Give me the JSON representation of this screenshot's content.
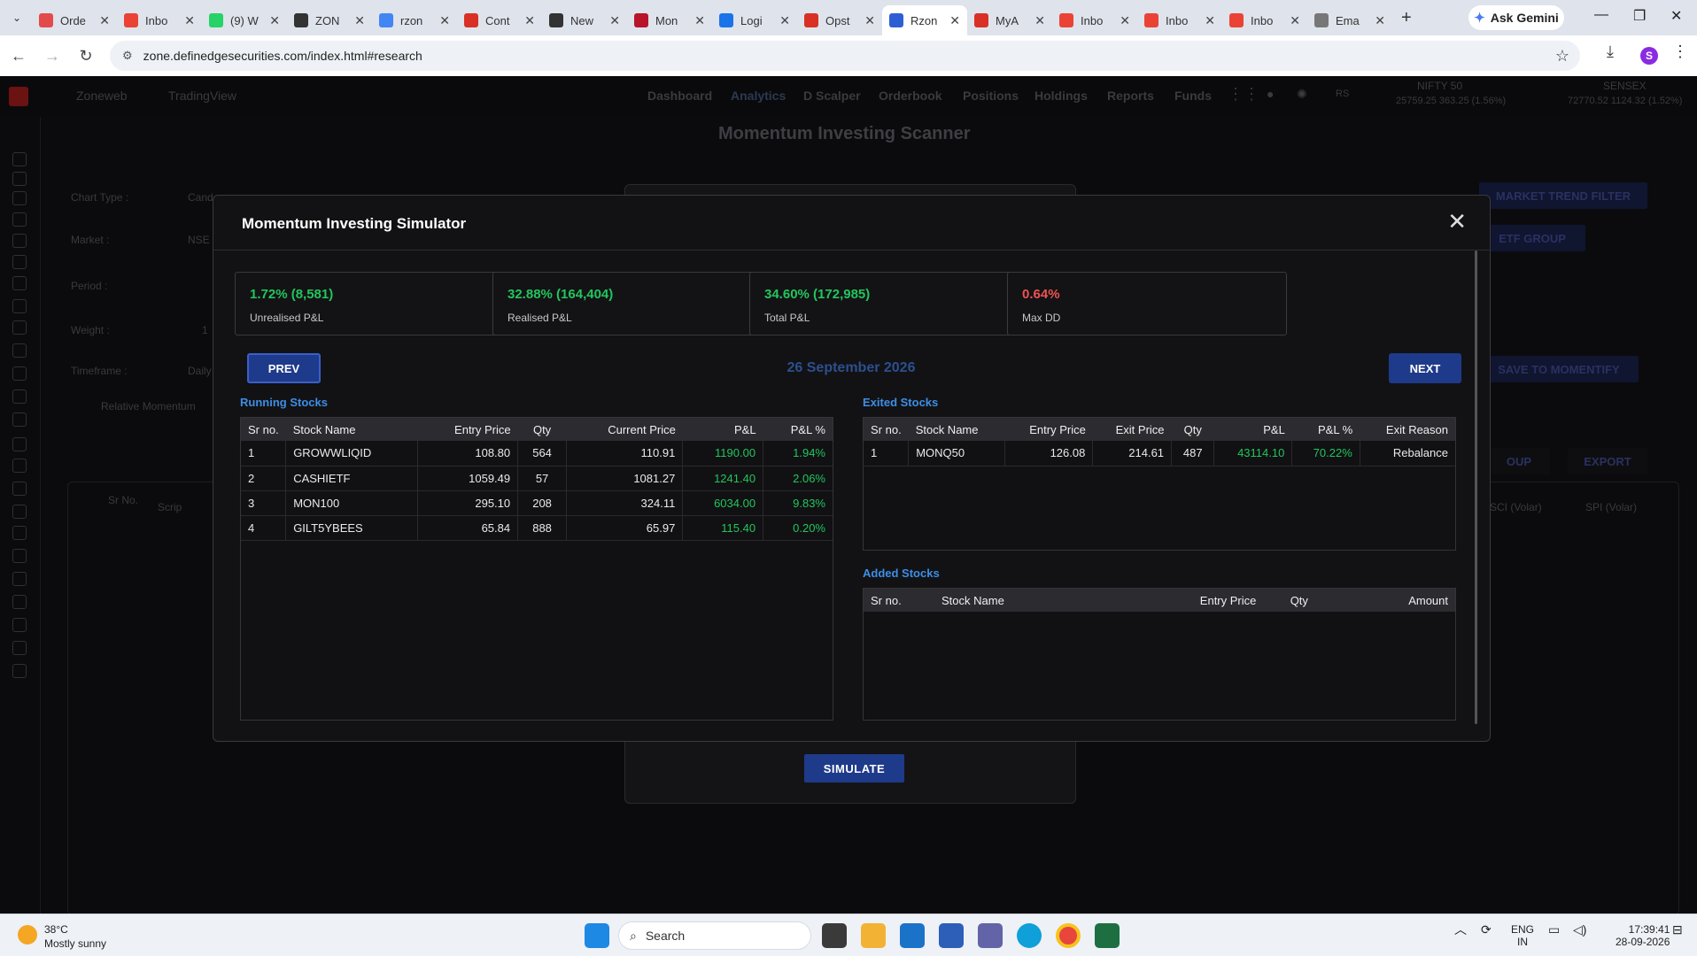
{
  "browser": {
    "tabs": [
      {
        "label": "Orde",
        "color": "#e34b4b"
      },
      {
        "label": "Inbo",
        "color": "#ea4335"
      },
      {
        "label": "(9) W",
        "color": "#25d366"
      },
      {
        "label": "ZON",
        "color": "#333333"
      },
      {
        "label": "rzon",
        "color": "#4285f4"
      },
      {
        "label": "Cont",
        "color": "#d93025"
      },
      {
        "label": "New",
        "color": "#333333"
      },
      {
        "label": "Mon",
        "color": "#b8142a"
      },
      {
        "label": "Logi",
        "color": "#1a73e8"
      },
      {
        "label": "Opst",
        "color": "#d93025"
      },
      {
        "label": "Rzon",
        "color": "#2c5fd3"
      },
      {
        "label": "MyA",
        "color": "#d93025"
      },
      {
        "label": "Inbo",
        "color": "#ea4335"
      },
      {
        "label": "Inbo",
        "color": "#ea4335"
      },
      {
        "label": "Inbo",
        "color": "#ea4335"
      },
      {
        "label": "Ema",
        "color": "#777777"
      }
    ],
    "active_tab_index": 10,
    "gemini_label": "Ask Gemini",
    "url": "zone.definedgesecurities.com/index.html#research",
    "profile_initial": "S"
  },
  "app_background": {
    "nav_left": [
      "Zoneweb",
      "TradingView"
    ],
    "nav_items": [
      "Dashboard",
      "Analytics",
      "D Scalper",
      "Orderbook",
      "Positions",
      "Holdings",
      "Reports",
      "Funds"
    ],
    "user_badge": "RS",
    "index1_name": "NIFTY 50",
    "index1_values": "25759.25   363.25 (1.56%)",
    "index2_name": "SENSEX",
    "index2_values": "72770.52   1124.32 (1.52%)",
    "page_title": "Momentum Investing Scanner",
    "form_labels": [
      "Chart Type :",
      "Market :",
      "Period :",
      "Weight :",
      "Timeframe :"
    ],
    "form_values": [
      "Cand",
      "NSE",
      "",
      "1",
      "Daily"
    ],
    "relative_momentum_label": "Relative Momentum",
    "right_buttons": [
      "MARKET TREND FILTER",
      "ETF GROUP",
      "SAVE TO MOMENTIFY",
      "OUP",
      "EXPORT"
    ],
    "table_headers": [
      "Sr No.",
      "Scrip",
      "SCI (Volar)",
      "SPI (Volar)"
    ],
    "simulate_label": "SIMULATE"
  },
  "modal": {
    "title": "Momentum Investing Simulator",
    "close_symbol": "✕",
    "summary": [
      {
        "value": "1.72% (8,581)",
        "label": "Unrealised P&L",
        "tone": "pos"
      },
      {
        "value": "32.88% (164,404)",
        "label": "Realised P&L",
        "tone": "pos"
      },
      {
        "value": "34.60% (172,985)",
        "label": "Total P&L",
        "tone": "pos"
      },
      {
        "value": "0.64%",
        "label": "Max DD",
        "tone": "neg"
      }
    ],
    "prev_label": "PREV",
    "next_label": "NEXT",
    "date": "26 September 2026",
    "running": {
      "title": "Running Stocks",
      "headers": [
        "Sr no.",
        "Stock Name",
        "Entry Price",
        "Qty",
        "Current Price",
        "P&L",
        "P&L %"
      ],
      "rows": [
        [
          "1",
          "GROWWLIQID",
          "108.80",
          "564",
          "110.91",
          "1190.00",
          "1.94%"
        ],
        [
          "2",
          "CASHIETF",
          "1059.49",
          "57",
          "1081.27",
          "1241.40",
          "2.06%"
        ],
        [
          "3",
          "MON100",
          "295.10",
          "208",
          "324.11",
          "6034.00",
          "9.83%"
        ],
        [
          "4",
          "GILT5YBEES",
          "65.84",
          "888",
          "65.97",
          "115.40",
          "0.20%"
        ]
      ]
    },
    "exited": {
      "title": "Exited Stocks",
      "headers": [
        "Sr no.",
        "Stock Name",
        "Entry Price",
        "Exit Price",
        "Qty",
        "P&L",
        "P&L %",
        "Exit Reason"
      ],
      "rows": [
        [
          "1",
          "MONQ50",
          "126.08",
          "214.61",
          "487",
          "43114.10",
          "70.22%",
          "Rebalance"
        ]
      ]
    },
    "added": {
      "title": "Added Stocks",
      "headers": [
        "Sr no.",
        "Stock Name",
        "Entry Price",
        "Qty",
        "Amount"
      ],
      "rows": []
    }
  },
  "taskbar": {
    "temperature": "38°C",
    "weather": "Mostly sunny",
    "search_placeholder": "Search",
    "lang_line1": "ENG",
    "lang_line2": "IN",
    "time": "17:39:41",
    "date": "28-09-2026"
  },
  "colors": {
    "accent_blue": "#1e3a8a",
    "positive": "#22c55e",
    "negative": "#f05252",
    "section_title": "#3d8ee6"
  }
}
